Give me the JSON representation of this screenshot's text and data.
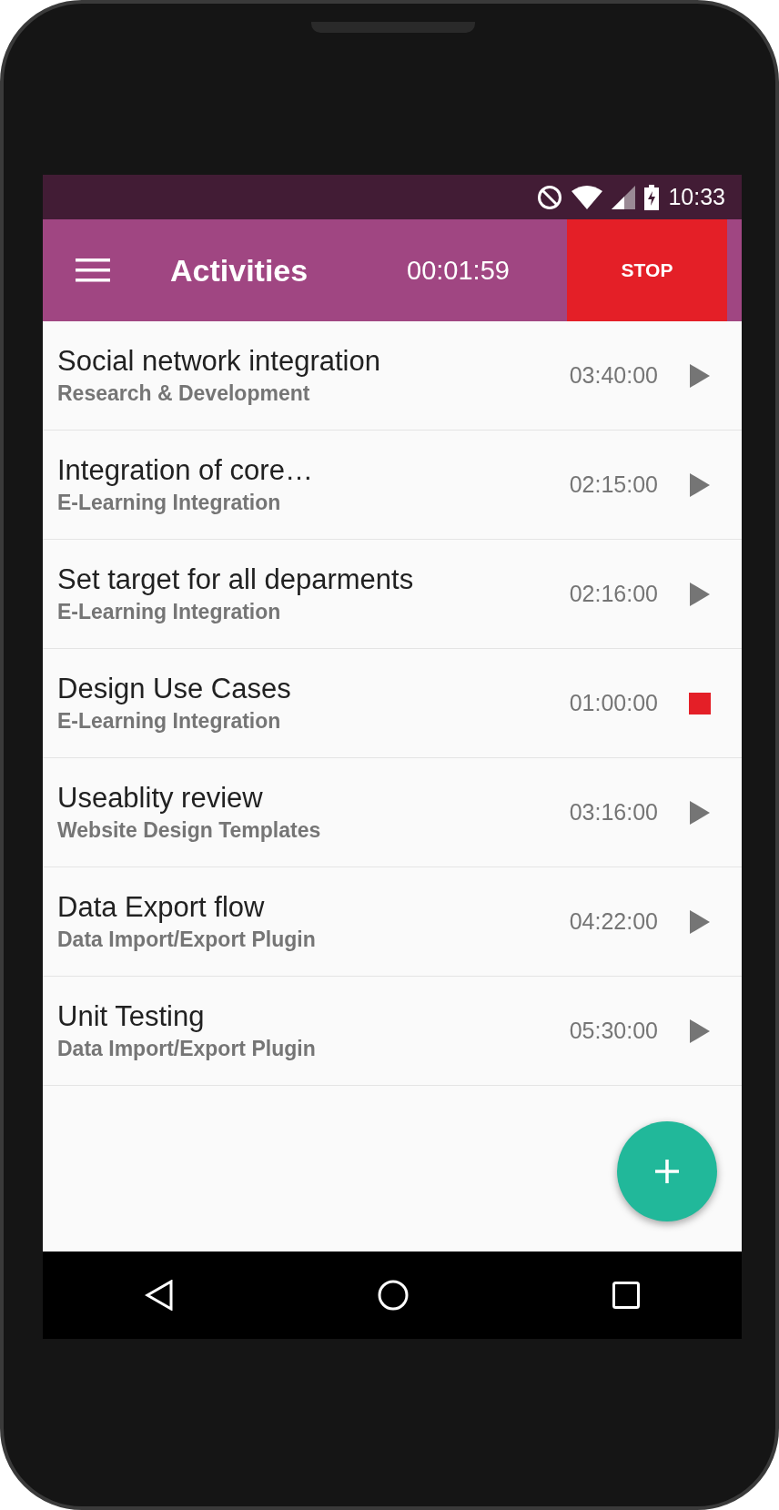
{
  "status_bar": {
    "time": "10:33"
  },
  "app_bar": {
    "title": "Activities",
    "timer": "00:01:59",
    "stop_button": "STOP"
  },
  "activities": [
    {
      "title": "Social network integration",
      "project": "Research & Development",
      "duration": "03:40:00",
      "running": false
    },
    {
      "title": "Integration of core…",
      "project": "E-Learning Integration",
      "duration": "02:15:00",
      "running": false
    },
    {
      "title": "Set target for all deparments",
      "project": "E-Learning Integration",
      "duration": "02:16:00",
      "running": false
    },
    {
      "title": "Design Use Cases",
      "project": "E-Learning Integration",
      "duration": "01:00:00",
      "running": true
    },
    {
      "title": "Useablity review",
      "project": "Website Design Templates",
      "duration": "03:16:00",
      "running": false
    },
    {
      "title": "Data Export flow",
      "project": "Data Import/Export Plugin",
      "duration": "04:22:00",
      "running": false
    },
    {
      "title": "Unit Testing",
      "project": "Data Import/Export Plugin",
      "duration": "05:30:00",
      "running": false
    }
  ]
}
